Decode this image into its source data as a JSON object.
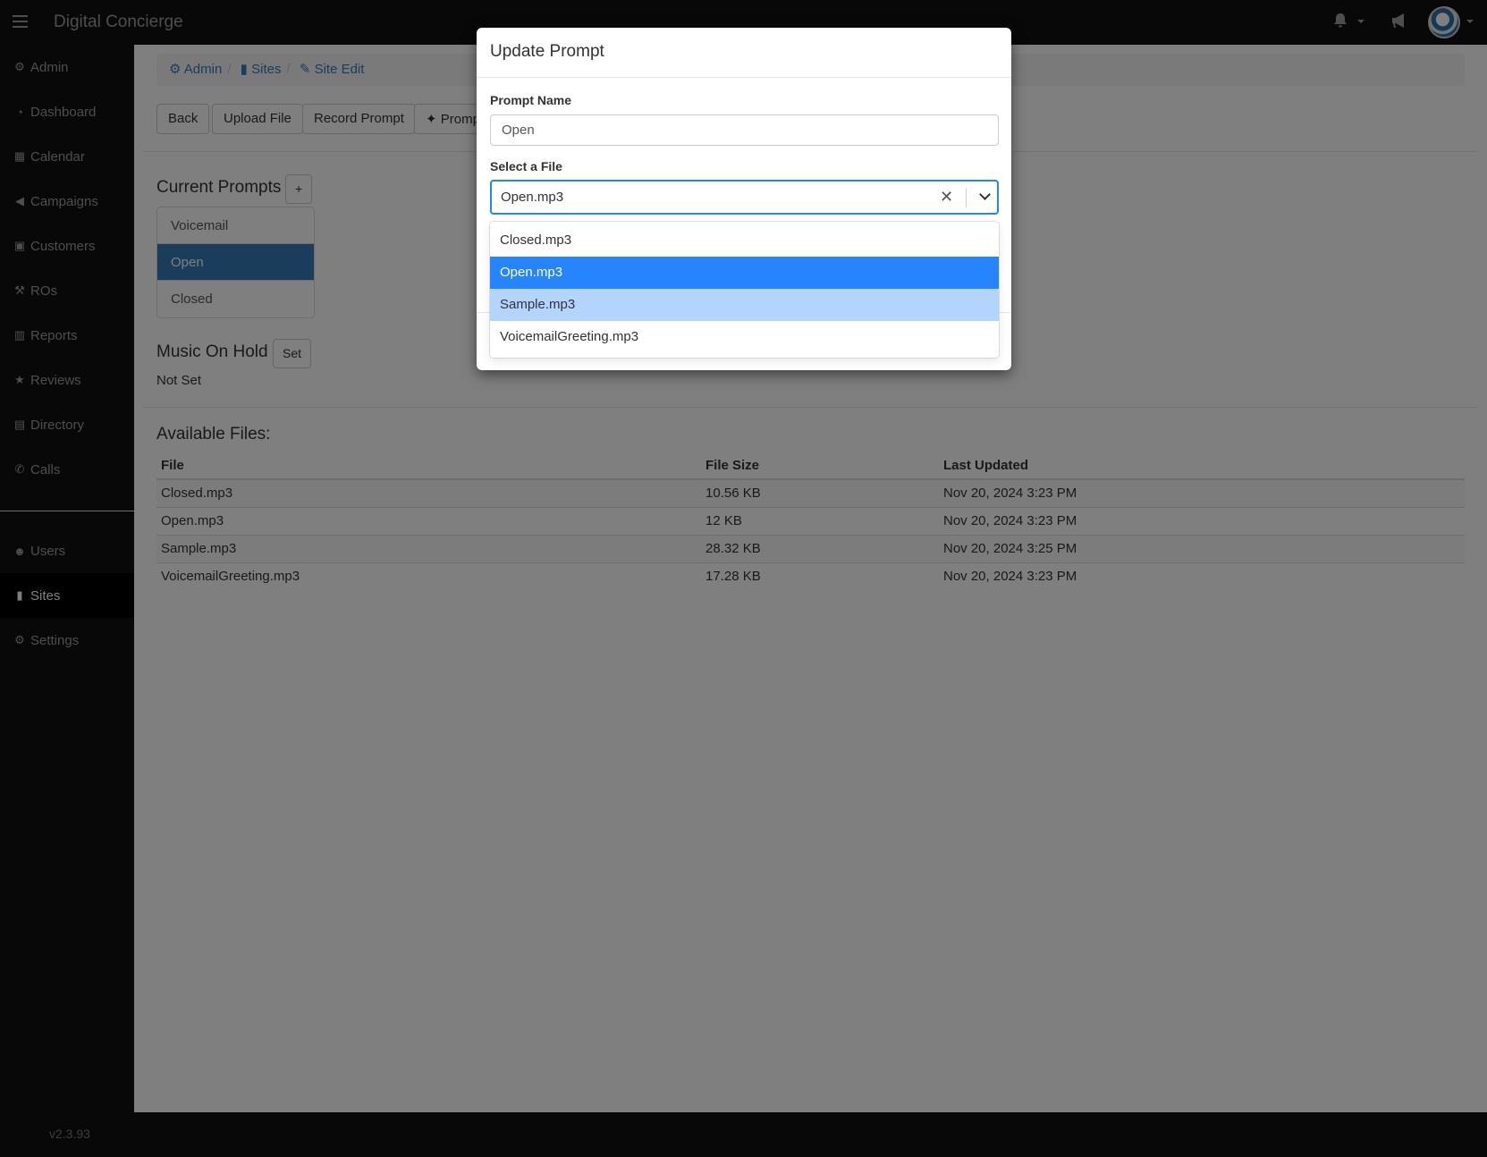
{
  "app": {
    "title": "Digital Concierge",
    "version": "v2.3.93"
  },
  "topbar": {
    "icons": [
      "bell-icon",
      "bullhorn-icon",
      "avatar"
    ]
  },
  "sidebar": {
    "items": [
      {
        "label": "Admin",
        "icon": "gear-icon"
      },
      {
        "label": "Dashboard",
        "icon": "dashboard-icon"
      },
      {
        "label": "Calendar",
        "icon": "calendar-icon"
      },
      {
        "label": "Campaigns",
        "icon": "bullhorn-icon"
      },
      {
        "label": "Customers",
        "icon": "contact-book-icon"
      },
      {
        "label": "ROs",
        "icon": "wrench-icon"
      },
      {
        "label": "Reports",
        "icon": "bar-chart-icon"
      },
      {
        "label": "Reviews",
        "icon": "star-icon"
      },
      {
        "label": "Directory",
        "icon": "book-icon"
      },
      {
        "label": "Calls",
        "icon": "phone-icon"
      },
      {
        "label": "Users",
        "icon": "users-icon"
      },
      {
        "label": "Sites",
        "icon": "building-icon",
        "active": true
      },
      {
        "label": "Settings",
        "icon": "gear-icon"
      }
    ]
  },
  "breadcrumb": {
    "admin": "Admin",
    "sites": "Sites",
    "site_edit": "Site Edit"
  },
  "toolbar": {
    "back": "Back",
    "upload": "Upload File",
    "record": "Record Prompt",
    "prompt": "Promp"
  },
  "prompts": {
    "heading": "Current Prompts",
    "add_label": "+",
    "items": [
      "Voicemail",
      "Open",
      "Closed"
    ],
    "active": "Open"
  },
  "music_on_hold": {
    "heading": "Music On Hold",
    "set_label": "Set",
    "value": "Not Set"
  },
  "files": {
    "heading": "Available Files:",
    "columns": [
      "File",
      "File Size",
      "Last Updated"
    ],
    "rows": [
      [
        "Closed.mp3",
        "10.56 KB",
        "Nov 20, 2024 3:23 PM"
      ],
      [
        "Open.mp3",
        "12 KB",
        "Nov 20, 2024 3:23 PM"
      ],
      [
        "Sample.mp3",
        "28.32 KB",
        "Nov 20, 2024 3:25 PM"
      ],
      [
        "VoicemailGreeting.mp3",
        "17.28 KB",
        "Nov 20, 2024 3:23 PM"
      ]
    ]
  },
  "modal": {
    "title": "Update Prompt",
    "prompt_name_label": "Prompt Name",
    "prompt_name_value": "Open",
    "select_label": "Select a File",
    "selected_value": "Open.mp3",
    "options": [
      "Closed.mp3",
      "Open.mp3",
      "Sample.mp3",
      "VoicemailGreeting.mp3"
    ],
    "selected_option": "Open.mp3",
    "focused_option": "Sample.mp3"
  },
  "colors": {
    "primary": "#337ab7",
    "select_accent": "#2684ff",
    "option_focus": "#b2d4ff",
    "navbar": "#101010"
  }
}
